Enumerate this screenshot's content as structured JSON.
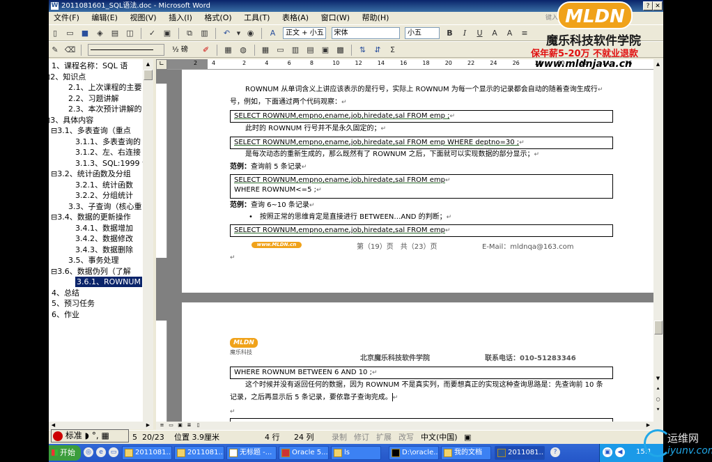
{
  "window": {
    "title": "2011081601_SQL语法.doc - Microsoft Word"
  },
  "menu": [
    "文件(F)",
    "编辑(E)",
    "视图(V)",
    "插入(I)",
    "格式(O)",
    "工具(T)",
    "表格(A)",
    "窗口(W)",
    "帮助(H)"
  ],
  "toolbar": {
    "style": "正文 + 小五",
    "font": "宋体",
    "size": "小五",
    "bold_label": "B",
    "italic_label": "I",
    "underline_label": "U",
    "line_weight": "½ 磅",
    "clipped_help": "键入需要帮助的问题"
  },
  "nav": [
    {
      "label": "1、课程名称：SQL 语",
      "indent": 0,
      "expander": ""
    },
    {
      "label": "2、知识点",
      "indent": 0,
      "expander": "⊟"
    },
    {
      "label": "2.1、上次课程的主要",
      "indent": 2,
      "expander": ""
    },
    {
      "label": "2.2、习题讲解",
      "indent": 2,
      "expander": ""
    },
    {
      "label": "2.3、本次预计讲解的",
      "indent": 2,
      "expander": ""
    },
    {
      "label": "3、具体内容",
      "indent": 0,
      "expander": "⊟"
    },
    {
      "label": "3.1、多表查询（重点",
      "indent": 1,
      "expander": "⊟"
    },
    {
      "label": "3.1.1、多表查询的",
      "indent": 3,
      "expander": ""
    },
    {
      "label": "3.1.2、左、右连接",
      "indent": 3,
      "expander": ""
    },
    {
      "label": "3.1.3、SQL:1999 语",
      "indent": 3,
      "expander": ""
    },
    {
      "label": "3.2、统计函数及分组",
      "indent": 1,
      "expander": "⊟"
    },
    {
      "label": "3.2.1、统计函数",
      "indent": 3,
      "expander": ""
    },
    {
      "label": "3.2.2、分组统计",
      "indent": 3,
      "expander": ""
    },
    {
      "label": "3.3、子查询（核心重",
      "indent": 2,
      "expander": ""
    },
    {
      "label": "3.4、数据的更新操作",
      "indent": 1,
      "expander": "⊟"
    },
    {
      "label": "3.4.1、数据增加",
      "indent": 3,
      "expander": ""
    },
    {
      "label": "3.4.2、数据修改",
      "indent": 3,
      "expander": ""
    },
    {
      "label": "3.4.3、数据删除",
      "indent": 3,
      "expander": ""
    },
    {
      "label": "3.5、事务处理",
      "indent": 2,
      "expander": ""
    },
    {
      "label": "3.6、数据伪列（了解",
      "indent": 1,
      "expander": "⊟"
    },
    {
      "label": "3.6.1、ROWNUM",
      "indent": 3,
      "expander": "",
      "selected": true
    },
    {
      "label": "4、总结",
      "indent": 0,
      "expander": ""
    },
    {
      "label": "5、预习任务",
      "indent": 0,
      "expander": ""
    },
    {
      "label": "6、作业",
      "indent": 0,
      "expander": ""
    }
  ],
  "ruler": [
    "2",
    "4",
    "2",
    "4",
    "6",
    "8",
    "10",
    "12",
    "14",
    "16",
    "18",
    "20",
    "22",
    "24",
    "26",
    "28",
    "30",
    "32",
    "34",
    "36"
  ],
  "page1": {
    "p1a": "ROWNUM 从单词含义上讲应该表示的是行号，实际上 ROWNUM 为每一个显示的记录都会自动的随着查询生成行",
    "p1b": "号，例如，下面通过两个代码观察：",
    "code1": "SELECT ROWNUM,empno,ename,job,hiredate,sal FROM emp ;",
    "p2": "此时的 ROWNUM 行号并不是永久固定的；",
    "code2": "SELECT ROWNUM,empno,ename,job,hiredate,sal FROM emp WHERE deptno=30 ;",
    "p3": "是每次动态的重新生成的，那么既然有了 ROWNUM 之后，下面就可以实现数据的部分显示；",
    "ex1_label": "范例：",
    "ex1_text": "查询前 5 条记录",
    "code3a": "SELECT ROWNUM,empno,ename,job,hiredate,sal FROM emp",
    "code3b": "WHERE ROWNUM<=5 ;",
    "ex2_label": "范例：",
    "ex2_text": "查询 6~10 条记录",
    "bullet": "按照正常的思维肯定是直接进行 BETWEEN…AND 的判断；",
    "code4": "SELECT ROWNUM,empno,ename,job,hiredate,sal FROM emp",
    "footer_page": "第（19）页　共（23）页",
    "footer_email": "E-Mail：mldnqa@163.com"
  },
  "page2": {
    "header_company": "北京魔乐科技软件学院",
    "header_phone": "联系电话：010-51283346",
    "logo_text": "MLDN",
    "logo_sub": "魔乐科技",
    "code5": "WHERE ROWNUM BETWEEN 6 AND 10 ;",
    "p4a": "这个时候并没有返回任何的数据，因为 ROWNUM 不是真实列，而要想真正的实现这种查询思路是：先查询前 10 条",
    "p4b": "记录，之后再显示后 5 条记录，要依靠子查询完成。"
  },
  "status": {
    "ime": "标准",
    "pages": "20/23",
    "position": "位置 3.9厘米",
    "line": "4 行",
    "col": "24 列",
    "rec": "录制",
    "trk": "修订",
    "ext": "扩展",
    "ovr": "改写",
    "lang": "中文(中国)",
    "section": "5"
  },
  "taskbar": {
    "start": "开始",
    "tasks": [
      "2011081...",
      "2011081...",
      "无标题 -...",
      "Oracle 5...",
      "ls",
      "D:\\oracle...",
      "我的文档",
      "2011081..."
    ],
    "clock": "15:1"
  },
  "overlay": {
    "logo": "MLDN",
    "school": "魔乐科技软件学院",
    "slogan": "保年薪5-20万 不就业退款",
    "url": "www.mldnjava.cn",
    "watermark1": "运维网",
    "watermark2": "iyunv.com"
  },
  "colors": {
    "title_bar": "#0a246a",
    "taskbar": "#2456c8",
    "selection": "#0a246a",
    "slogan": "#e01010",
    "brand": "#f0a21a"
  }
}
